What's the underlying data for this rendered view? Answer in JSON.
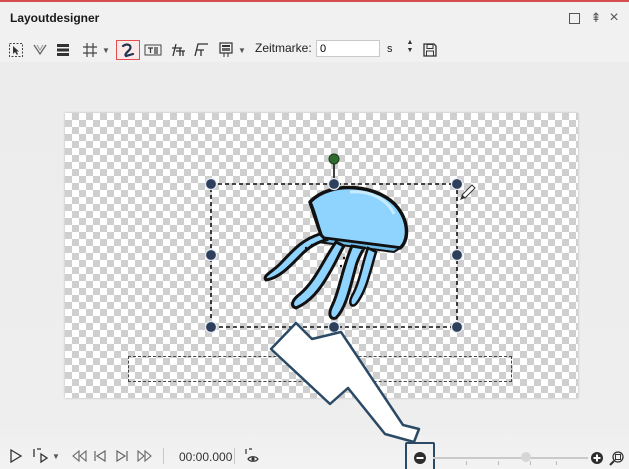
{
  "window": {
    "title": "Layoutdesigner",
    "accent_color": "#d54d4d",
    "controls": [
      "maximize-icon",
      "pin-icon",
      "close-icon"
    ],
    "close_glyph": "×",
    "pin_glyph": "⇞"
  },
  "toolbar": {
    "tools": [
      "select-icon",
      "snap-icon",
      "stack-icon",
      "grid-icon",
      "path-icon",
      "textbox-icon",
      "align-left-icon",
      "align-right-icon",
      "display-icon"
    ],
    "active_tool": "path-icon",
    "zeitmarke_label": "Zeitmarke:",
    "zeitmarke_value": "0",
    "zeitmarke_unit": "s",
    "spinner_up": "▲",
    "spinner_down": "▼",
    "save_icon": "save-icon",
    "dropdown_glyph": "▼"
  },
  "canvas": {
    "background": "transparent-checkerboard",
    "object": "jellyfish",
    "jellyfish_color": "#8fd3ff",
    "selection_handle_color": "#2e3f5c",
    "rotation_handle_color": "#2f6b2f"
  },
  "bottombar": {
    "controls": [
      "play-icon",
      "play-from-icon",
      "prev-mark-icon",
      "prev-frame-icon",
      "next-frame-icon",
      "next-mark-icon"
    ],
    "time": "00:00.000",
    "zoom_out_icon": "zoom-out-icon",
    "zoom_in_icon": "zoom-in-icon",
    "zoom_fit_icon": "zoom-fit-icon",
    "zoom_level": 0.6
  },
  "callout": {
    "arrow_color": "#ffffff",
    "arrow_outline": "#2b4a66"
  }
}
